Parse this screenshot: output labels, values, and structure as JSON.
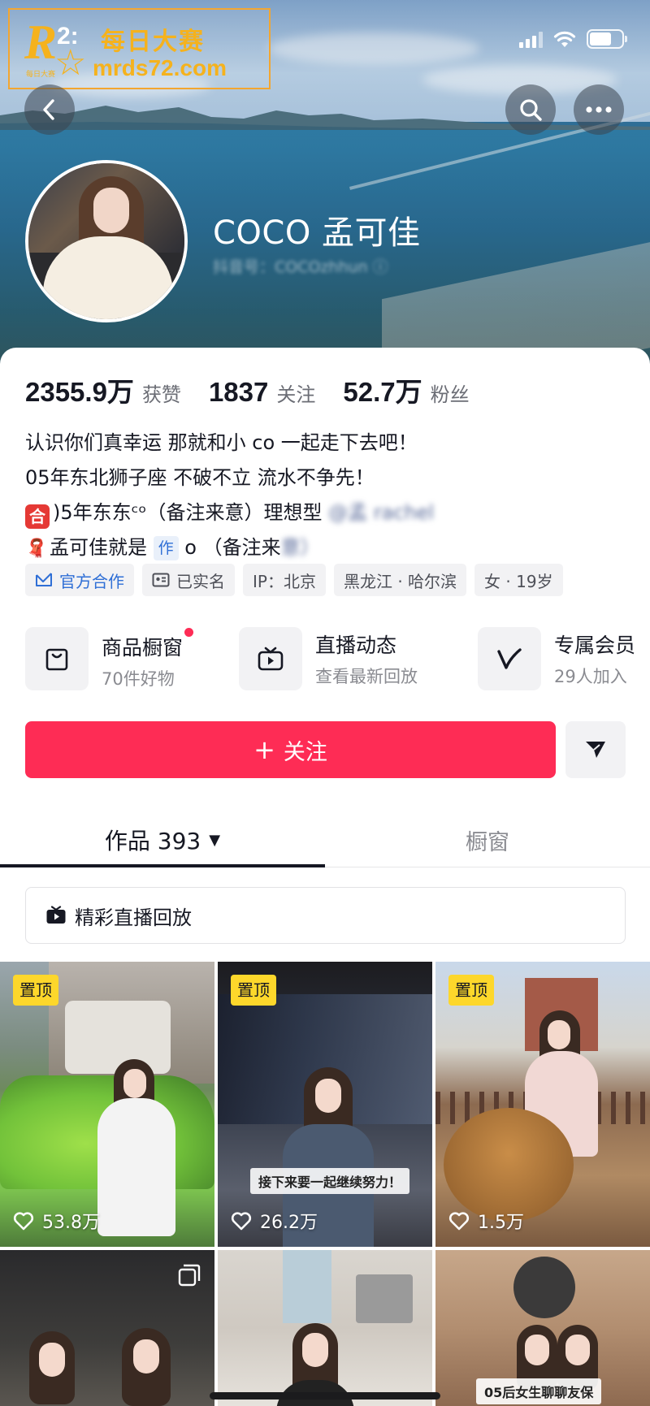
{
  "status_bar": {
    "time_partial": "2:",
    "signal": "signal-icon",
    "wifi": "wifi-icon",
    "battery_level": 0.68
  },
  "watermark": {
    "logo_letter": "R",
    "logo_small": "每日大赛",
    "title": "每日大赛",
    "url": "mrds72.com"
  },
  "profile": {
    "nickname": "COCO 孟可佳",
    "douyin_id": "抖音号：COCOzhhun ⓘ"
  },
  "stats": [
    {
      "value": "2355.9万",
      "label": "获赞"
    },
    {
      "value": "1837",
      "label": "关注"
    },
    {
      "value": "52.7万",
      "label": "粉丝"
    }
  ],
  "bio": {
    "line1": "认识你们真幸运  那就和小 co 一起走下去吧！",
    "line2": "05年东北狮子座 不破不立 流水不争先！",
    "line3_emoji": "合",
    "line3_a": ")5年东东ᶜᵒ（备注来意）理想型",
    "line3_blur": "@孟 rachel",
    "line4_emoji": "🧣",
    "line4_a": "孟可佳就是",
    "line4_tag": "作",
    "line4_b": " o   （备注来",
    "line4_blur": "意）"
  },
  "tags": [
    {
      "label": "官方合作",
      "icon": "official-partner-icon"
    },
    {
      "label": "已实名",
      "icon": "id-card-icon"
    },
    {
      "label": "IP：北京",
      "icon": ""
    },
    {
      "label": "黑龙江 · 哈尔滨",
      "icon": ""
    },
    {
      "label": "女 · 19岁",
      "icon": ""
    }
  ],
  "features": [
    {
      "title": "商品橱窗",
      "sub": "70件好物",
      "icon": "shopping-bag-icon",
      "dot": true
    },
    {
      "title": "直播动态",
      "sub": "查看最新回放",
      "icon": "tv-icon",
      "dot": false
    },
    {
      "title": "专属会员",
      "sub": "29人加入",
      "icon": "v-member-icon",
      "dot": false
    }
  ],
  "actions": {
    "follow": "关注",
    "share_icon": "send-icon"
  },
  "tabs": {
    "works": "作品 393",
    "shop": "橱窗"
  },
  "live_replay": "精彩直播回放",
  "videos": [
    {
      "pinned": "置顶",
      "likes": "53.8万",
      "caption": ""
    },
    {
      "pinned": "置顶",
      "likes": "26.2万",
      "caption": "接下来要一起继续努力！"
    },
    {
      "pinned": "置顶",
      "likes": "1.5万",
      "caption": ""
    },
    {
      "pinned": "",
      "likes": "",
      "caption": ""
    },
    {
      "pinned": "",
      "likes": "",
      "caption": ""
    },
    {
      "pinned": "",
      "likes": "",
      "caption": "05后女生聊聊友保"
    }
  ],
  "colors": {
    "accent": "#fe2c55",
    "pin": "#fdd72b",
    "official": "#2f6fd6",
    "watermark": "#f5b21d"
  }
}
